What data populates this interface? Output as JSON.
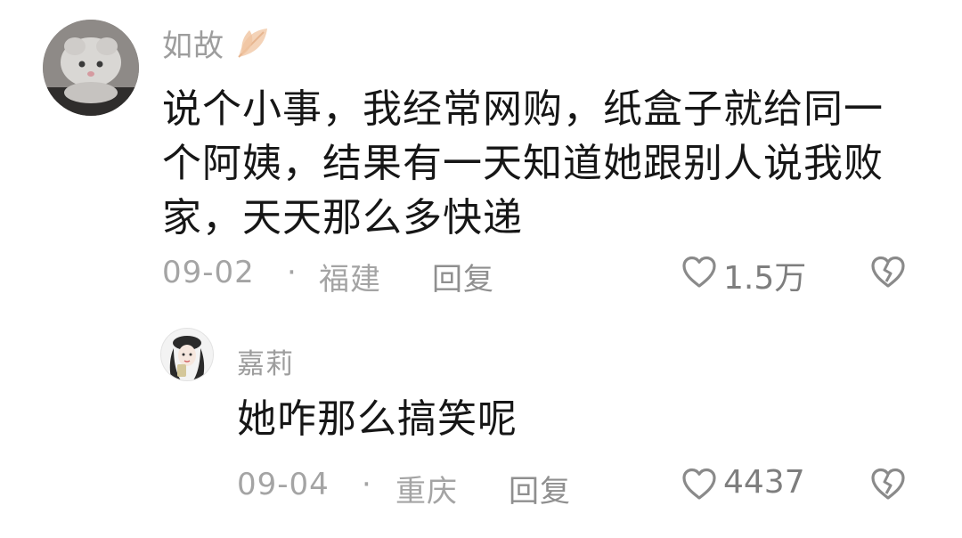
{
  "comment": {
    "username": "如故",
    "badge_icon": "leaf-icon",
    "content_lines": [
      "说个小事，我经常网购，纸盒子就给同一",
      "个阿姨，结果有一天知道她跟别人说我败",
      "家，天天那么多快递"
    ],
    "date": "09-02",
    "separator": "·",
    "location": "福建",
    "reply_label": "回复",
    "like_count": "1.5万",
    "like_icon": "heart-outline-icon",
    "dislike_icon": "broken-heart-icon",
    "avatar_icon": "cat-avatar-icon"
  },
  "reply": {
    "username": "嘉莉",
    "content": "她咋那么搞笑呢",
    "date": "09-04",
    "separator": "·",
    "location": "重庆",
    "reply_label": "回复",
    "like_count": "4437",
    "like_icon": "heart-outline-icon",
    "dislike_icon": "broken-heart-icon",
    "avatar_icon": "girl-avatar-icon"
  },
  "colors": {
    "text_primary": "#161616",
    "text_secondary": "#9d9d9d",
    "text_meta": "#a4a4a4",
    "badge": "#f0c4a0",
    "icon_stroke": "#8a8a8a"
  }
}
